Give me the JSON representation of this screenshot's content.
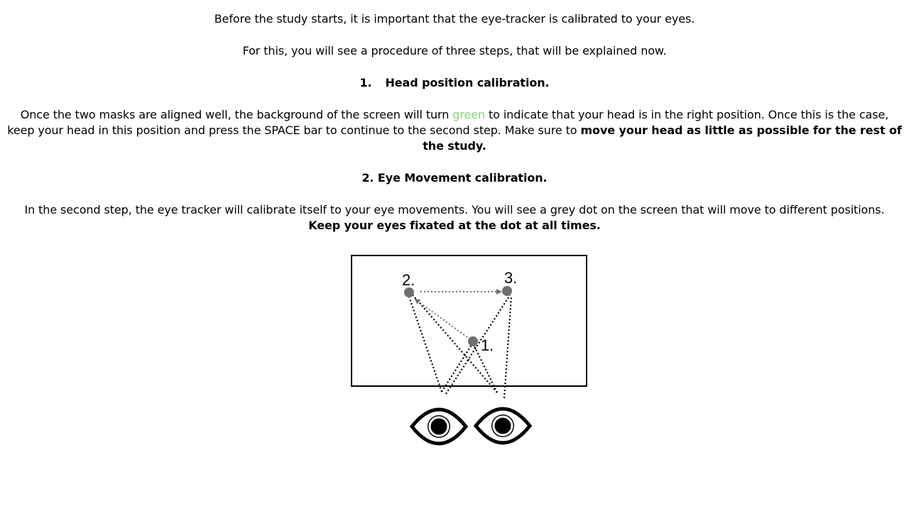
{
  "intro": {
    "line1": "Before the study starts, it is important that the eye-tracker is calibrated to your eyes.",
    "line2": "For this, you will see a procedure of three steps, that will be explained now."
  },
  "step1": {
    "number": "1.",
    "title": "Head position calibration.",
    "text_a": "Once the two masks are aligned well, the background of the screen will turn ",
    "green_word": "green",
    "text_b": " to indicate that your head is in the right position. Once this is the case, keep your head in this position and press the SPACE bar to continue to the second step. Make sure to ",
    "bold_text": "move your head as little as possible for the rest of the study."
  },
  "step2": {
    "title": "2. Eye Movement calibration.",
    "text": "In the second step, the eye tracker will calibrate itself to your eye movements. You will see a grey dot on the screen that will move to different positions.",
    "bold_text": "Keep your eyes fixated at the dot at all times."
  },
  "diagram": {
    "dot_labels": [
      "1.",
      "2.",
      "3."
    ],
    "colors": {
      "dot": "#707070",
      "green": "#8cd17d"
    }
  }
}
